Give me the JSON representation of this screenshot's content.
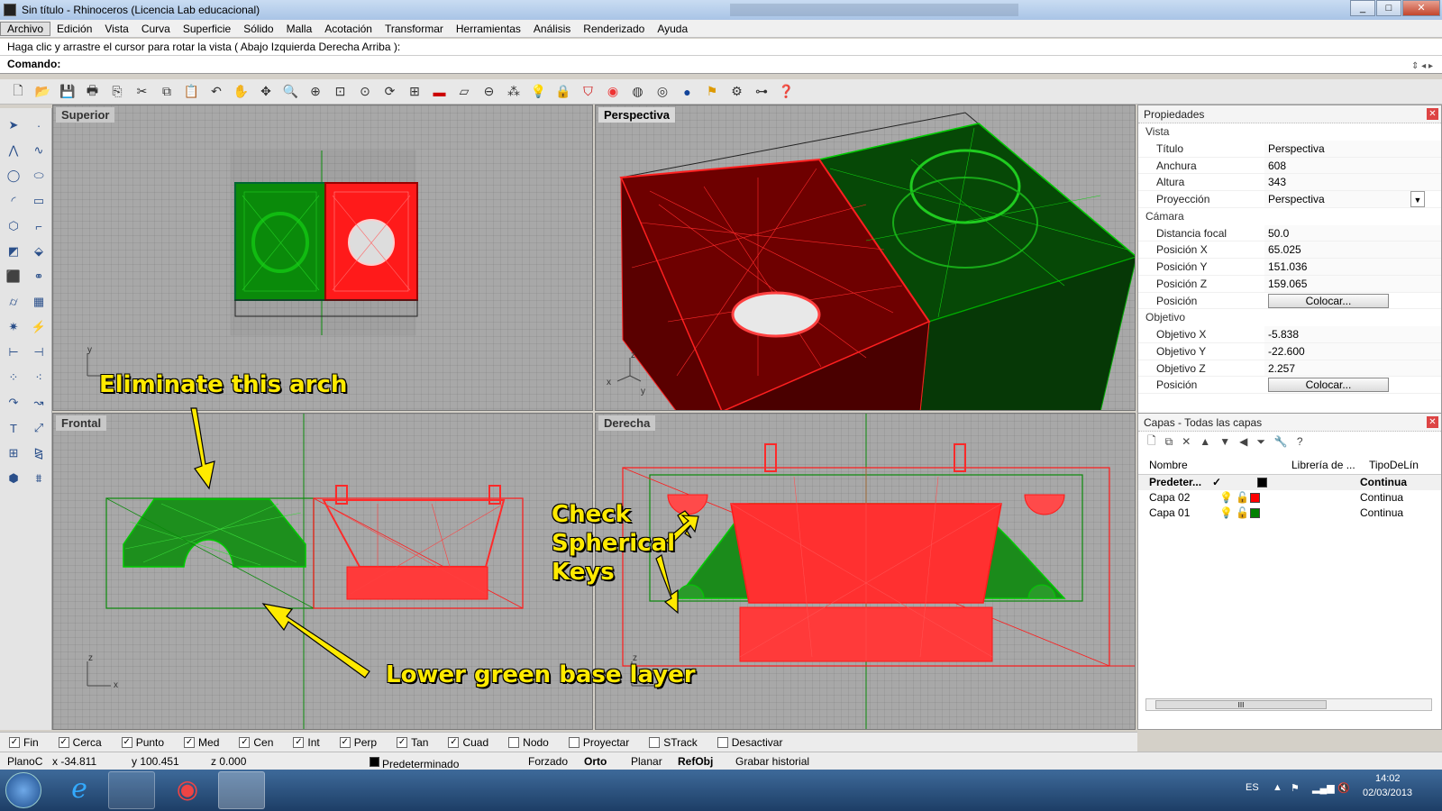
{
  "window": {
    "title": "Sin título - Rhinoceros (Licencia Lab educacional)",
    "min": "_",
    "max": "□",
    "close": "✕"
  },
  "menu": [
    "Archivo",
    "Edición",
    "Vista",
    "Curva",
    "Superficie",
    "Sólido",
    "Malla",
    "Acotación",
    "Transformar",
    "Herramientas",
    "Análisis",
    "Renderizado",
    "Ayuda"
  ],
  "prompt": "Haga clic y arrastre el cursor para rotar la vista ( Abajo  Izquierda  Derecha  Arriba ):",
  "command": {
    "label": "Comando:",
    "value": ""
  },
  "viewports": {
    "top": "Superior",
    "perspective": "Perspectiva",
    "front": "Frontal",
    "right": "Derecha"
  },
  "axes": {
    "x": "x",
    "y": "y",
    "z": "z"
  },
  "annotations": {
    "arch": "Eliminate this arch",
    "base": "Lower green base layer",
    "keys1": "Check",
    "keys2": "Spherical",
    "keys3": "Keys"
  },
  "properties": {
    "title": "Propiedades",
    "vista": "Vista",
    "rows_vista": [
      {
        "k": "Título",
        "v": "Perspectiva"
      },
      {
        "k": "Anchura",
        "v": "608"
      },
      {
        "k": "Altura",
        "v": "343"
      },
      {
        "k": "Proyección",
        "v": "Perspectiva"
      }
    ],
    "camara": "Cámara",
    "rows_camara": [
      {
        "k": "Distancia focal",
        "v": "50.0"
      },
      {
        "k": "Posición X",
        "v": "65.025"
      },
      {
        "k": "Posición Y",
        "v": "151.036"
      },
      {
        "k": "Posición Z",
        "v": "159.065"
      }
    ],
    "pos_label": "Posición",
    "place_btn": "Colocar...",
    "objetivo": "Objetivo",
    "rows_obj": [
      {
        "k": "Objetivo X",
        "v": "-5.838"
      },
      {
        "k": "Objetivo Y",
        "v": "-22.600"
      },
      {
        "k": "Objetivo Z",
        "v": "2.257"
      }
    ]
  },
  "layers": {
    "title": "Capas - Todas las capas",
    "cols": {
      "name": "Nombre",
      "lib": "Librería de ...",
      "type": "TipoDeLín"
    },
    "rows": [
      {
        "name": "Predeter...",
        "check": "✓",
        "color": "#000000",
        "type": "Continua",
        "current": true
      },
      {
        "name": "Capa 02",
        "check": "",
        "color": "#ff0000",
        "type": "Continua",
        "current": false
      },
      {
        "name": "Capa 01",
        "check": "",
        "color": "#008000",
        "type": "Continua",
        "current": false
      }
    ],
    "scroll": "III"
  },
  "osnaps": [
    {
      "label": "Fin",
      "on": true
    },
    {
      "label": "Cerca",
      "on": true
    },
    {
      "label": "Punto",
      "on": true
    },
    {
      "label": "Med",
      "on": true
    },
    {
      "label": "Cen",
      "on": true
    },
    {
      "label": "Int",
      "on": true
    },
    {
      "label": "Perp",
      "on": true
    },
    {
      "label": "Tan",
      "on": true
    },
    {
      "label": "Cuad",
      "on": true
    },
    {
      "label": "Nodo",
      "on": false
    },
    {
      "label": "Proyectar",
      "on": false
    },
    {
      "label": "STrack",
      "on": false
    },
    {
      "label": "Desactivar",
      "on": false
    }
  ],
  "status": {
    "plane": "PlanoC",
    "x": "x -34.811",
    "y": "y 100.451",
    "z": "z 0.000",
    "layer": "Predeterminado",
    "forced": "Forzado",
    "orto": "Orto",
    "planar": "Planar",
    "refobj": "RefObj",
    "history": "Grabar historial"
  },
  "tray": {
    "lang": "ES",
    "time": "14:02",
    "date": "02/03/2013"
  },
  "colors": {
    "green": "#0a8a0a",
    "red": "#ff1a1a",
    "callout": "#ffea00"
  }
}
